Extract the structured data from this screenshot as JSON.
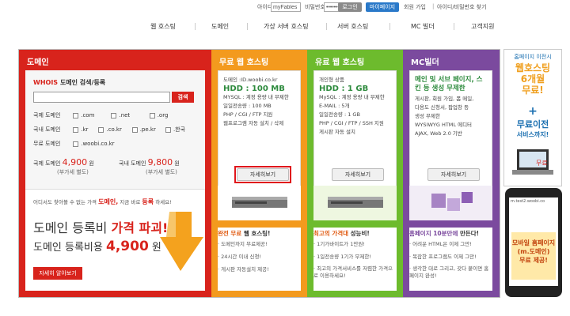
{
  "login": {
    "id_label": "아이디",
    "id_value": "myFables",
    "pw_label": "비밀번호",
    "pw_value": "••••••••",
    "login_button": "로그인",
    "mypage_button": "마이페이지",
    "join_link": "회원 가입",
    "find_link": "아이디/비밀번호 찾기"
  },
  "nav": [
    "웹 호스팅",
    "도메인",
    "가상 서버 호스팅",
    "서버 호스팅",
    "MC 빌더",
    "고객지원"
  ],
  "domain": {
    "title": "도메인",
    "whois_label": "WHOIS",
    "search_label": "도메인 검색/등록",
    "search_button": "검색",
    "rows": [
      {
        "label": "국제 도메인",
        "opts": [
          ".com",
          ".net",
          ".org"
        ]
      },
      {
        "label": "국내 도메인",
        "opts": [
          ".kr",
          ".co.kr",
          ".pe.kr",
          ".한국"
        ]
      },
      {
        "label": "무료 도메인",
        "opts": [
          ".woobi.co.kr"
        ]
      }
    ],
    "intl_price_label": "국제 도메인",
    "intl_price": "4,900",
    "intl_unit": "원",
    "dom_price_label": "국내 도메인",
    "dom_price": "9,800",
    "dom_unit": "원",
    "vat1": "(부가세 별도)",
    "vat2": "(부가세 별도)",
    "promo_small": "어디서도 찾아볼 수 없는 가격",
    "promo_small_red1": "도메인,",
    "promo_small2": "지금 바로",
    "promo_small_red2": "등록",
    "promo_small3": "하세요!",
    "promo_big1": "도메인 등록비",
    "promo_big2": "가격 파괴!",
    "promo_price_label": "도메인 등록비용",
    "promo_price": "4,900",
    "promo_unit": "원",
    "promo_button": "자세히 알아보기"
  },
  "free": {
    "title": "무료 웹 호스팅",
    "domain": "도메인 :ID.woobi.co.kr",
    "hdd": "HDD : 100 MB",
    "specs": [
      "MYSQL : 계정 용량 내 무제한",
      "일일전송량 : 100 MB",
      "PHP / CGI / FTP 지원",
      "웹프로그램 자동 설치 / 삭제"
    ],
    "button": "자세히보기",
    "banner_red": "완전 무료",
    "banner_rest": "웹 호스팅!",
    "bullets": [
      "도메인까지 무료제공!",
      "24시간 이내 신청!",
      "게시판 자동설치 제공!"
    ]
  },
  "paid": {
    "title": "유료 웹 호스팅",
    "plan": "개인형 상품",
    "hdd": "HDD : 1 GB",
    "specs": [
      "MySQL : 계정 용량 내 무제한",
      "E-MAIL : 5개",
      "일일전송량 : 1 GB",
      "PHP / CGI / FTP / SSH 지원",
      "게시판 자동 설치"
    ],
    "button": "자세히보기",
    "banner_red": "최고의 가격대",
    "banner_rest": "성능비!",
    "bullets": [
      "1기가바이트가 1만원!",
      "1일전송량 1기가 무제한!",
      "최고의 가격서비스를 저렴한 가격으로 이용하세요!"
    ]
  },
  "mc": {
    "title": "MC빌더",
    "headline": "메인 및 서브 페이지, 스킨 등 생성 무제한",
    "specs": [
      "게시판, 회원 가입, 폼 메일,",
      "다용도 신청서, 팝업창 등",
      "생성 무제한",
      "WYSIWYG HTML 에디터",
      "AJAX, Web 2.0 기반"
    ],
    "button": "자세히보기",
    "banner_red": "홈페이지 10분만에",
    "banner_rest": "만든다!",
    "bullets": [
      "어려운 HTML은 이제 그만!",
      "복잡한 프로그램도 이제 그만!",
      "생각한 대로 그리고, 갖다 붙이면 홈페이지 완성!"
    ]
  },
  "side": {
    "top_label": "홈페이지 이전시",
    "line1": "웹호스팅",
    "line2": "6개월",
    "line3": "무료!",
    "plus": "+",
    "line4": "무료이전",
    "line5": "서비스까지!",
    "phone_url": "m.test2.woobi.co",
    "phone1": "모바일 홈페이지",
    "phone2": "(m.도메인)",
    "phone3": "무료 제공!"
  },
  "colors": {
    "red": "#d8231c",
    "orange": "#f39a1e",
    "green": "#6dbb2d",
    "purple": "#7b4a9e"
  }
}
